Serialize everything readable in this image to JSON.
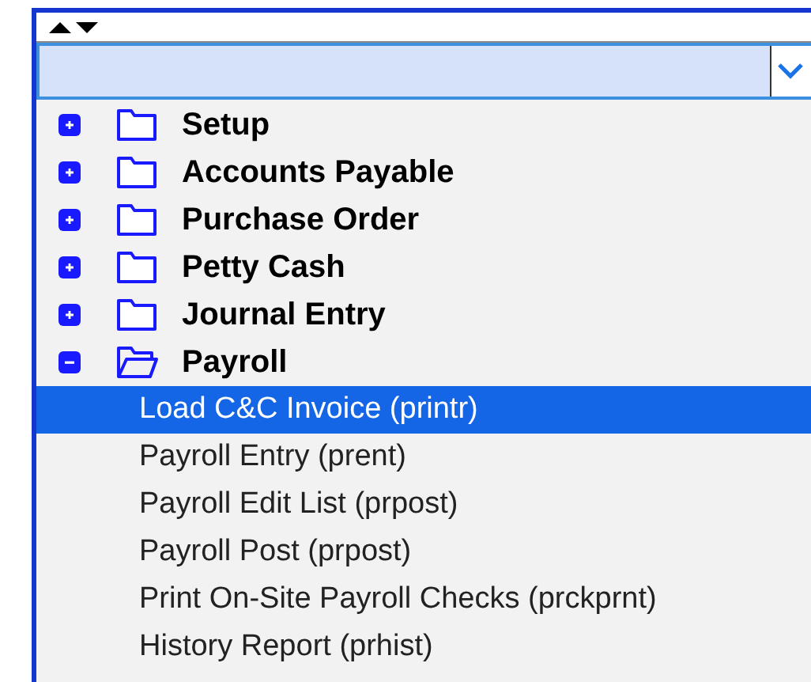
{
  "tree": [
    {
      "label": "Setup",
      "expanded": false
    },
    {
      "label": "Accounts Payable",
      "expanded": false
    },
    {
      "label": "Purchase Order",
      "expanded": false
    },
    {
      "label": "Petty Cash",
      "expanded": false
    },
    {
      "label": "Journal Entry",
      "expanded": false
    },
    {
      "label": "Payroll",
      "expanded": true,
      "children": [
        {
          "label": "Load C&C Invoice (printr)",
          "selected": true
        },
        {
          "label": "Payroll Entry (prent)",
          "selected": false
        },
        {
          "label": "Payroll Edit List (prpost)",
          "selected": false
        },
        {
          "label": "Payroll Post (prpost)",
          "selected": false
        },
        {
          "label": "Print On-Site Payroll Checks (prckprnt)",
          "selected": false
        },
        {
          "label": "History Report (prhist)",
          "selected": false
        }
      ]
    }
  ]
}
